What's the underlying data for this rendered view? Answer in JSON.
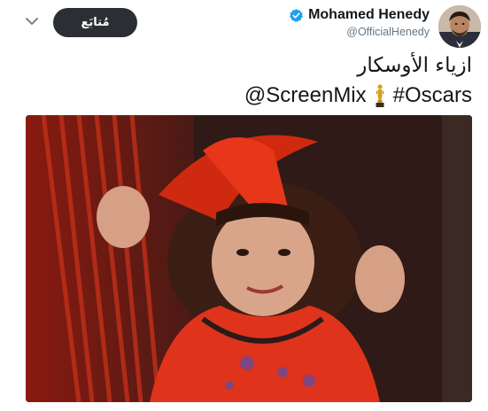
{
  "header": {
    "follow_label": "مُتابَع",
    "display_name": "Mohamed Henedy",
    "handle": "@OfficialHenedy"
  },
  "tweet": {
    "line1": "ازياء الأوسكار",
    "mention": "@ScreenMix",
    "hashtag": "#Oscars"
  },
  "icons": {
    "chevron": "chevron-down-icon",
    "verified": "verified-badge-icon",
    "oscar": "oscar-statuette-emoji"
  },
  "colors": {
    "verified_blue": "#1da1f2",
    "follow_bg": "#2b2f33",
    "handle_gray": "#657786"
  }
}
